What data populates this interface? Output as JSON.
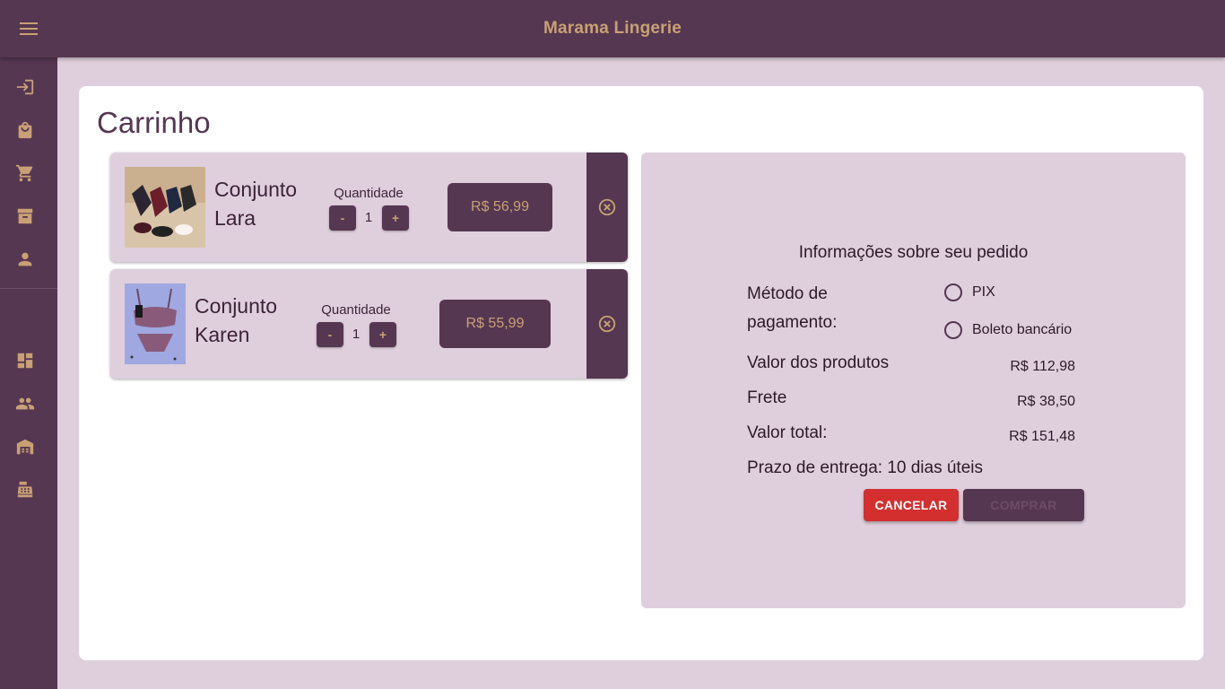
{
  "app": {
    "title": "Marama Lingerie",
    "menu_icon": "menu-icon"
  },
  "colors": {
    "primary": "#553751",
    "accent": "#c9a074",
    "background": "#dfcfdd",
    "danger": "#d32f2f"
  },
  "sidebar": {
    "items": [
      {
        "icon": "login-icon",
        "name": "sidebar-item-login"
      },
      {
        "icon": "shopping-bag-icon",
        "name": "sidebar-item-shop"
      },
      {
        "icon": "cart-icon",
        "name": "sidebar-item-cart"
      },
      {
        "icon": "archive-icon",
        "name": "sidebar-item-orders"
      },
      {
        "icon": "person-icon",
        "name": "sidebar-item-account"
      },
      {
        "icon": "dashboard-icon",
        "name": "sidebar-item-dashboard"
      },
      {
        "icon": "people-icon",
        "name": "sidebar-item-users"
      },
      {
        "icon": "warehouse-icon",
        "name": "sidebar-item-stock"
      },
      {
        "icon": "cash-register-icon",
        "name": "sidebar-item-sales"
      }
    ]
  },
  "page": {
    "title": "Carrinho"
  },
  "cart": {
    "items": [
      {
        "name_line1": "Conjunto",
        "name_line2": "Lara",
        "quantity_label": "Quantidade",
        "quantity": "1",
        "minus_label": "-",
        "plus_label": "+",
        "price": "R$ 56,99",
        "remove_icon": "close-circle-icon",
        "thumbnail": "product-photo-icon"
      },
      {
        "name_line1": "Conjunto",
        "name_line2": "Karen",
        "quantity_label": "Quantidade",
        "quantity": "1",
        "minus_label": "-",
        "plus_label": "+",
        "price": "R$ 55,99",
        "remove_icon": "close-circle-icon",
        "thumbnail": "product-photo-icon"
      }
    ]
  },
  "order": {
    "title": "Informações sobre seu pedido",
    "payment_label_line1": "Método de",
    "payment_label_line2": "pagamento:",
    "payment_options": [
      "PIX",
      "Boleto bancário"
    ],
    "products_label": "Valor dos produtos",
    "products_value": "R$ 112,98",
    "shipping_label": "Frete",
    "shipping_value": "R$ 38,50",
    "total_label": "Valor total:",
    "total_value": "R$ 151,48",
    "delivery_label": "Prazo de entrega: 10 dias úteis",
    "cancel_label": "CANCELAR",
    "buy_label": "COMPRAR"
  }
}
